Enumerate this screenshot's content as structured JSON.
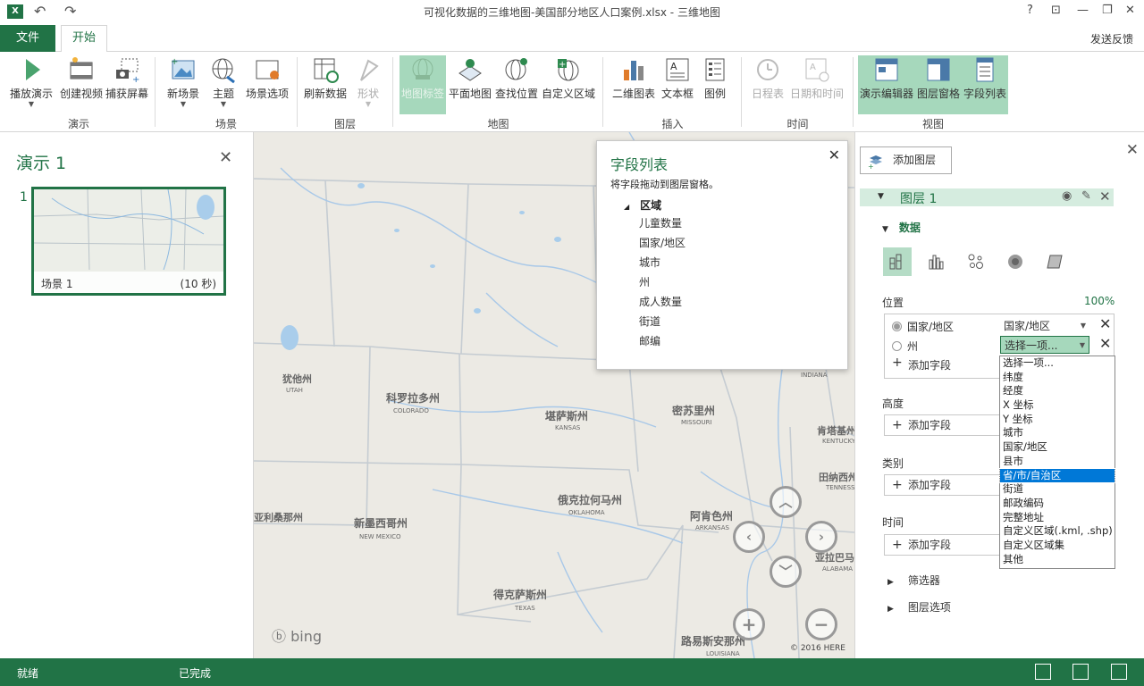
{
  "titlebar": {
    "app_icon": "X",
    "title": "可视化数据的三维地图-美国部分地区人口案例.xlsx - 三维地图",
    "undo_icon": "↶",
    "redo_icon": "↷",
    "help": "?",
    "restore_icon": "⊡",
    "minimize": "—",
    "maximize": "❐",
    "close": "✕"
  },
  "tabs": {
    "file": "文件",
    "home": "开始",
    "feedback": "发送反馈"
  },
  "ribbon": {
    "play_tour": "播放演示",
    "create_video": "创建视频",
    "capture_screen": "捕获屏幕",
    "group_tour": "演示",
    "new_scene": "新场景",
    "theme": "主题",
    "scene_options": "场景选项",
    "group_scene": "场景",
    "refresh_data": "刷新数据",
    "shapes": "形状",
    "group_layer": "图层",
    "map_labels": "地图标签",
    "flat_map": "平面地图",
    "find_location": "查找位置",
    "custom_regions": "自定义区域",
    "group_map": "地图",
    "chart_2d": "二维图表",
    "text_box": "文本框",
    "legend": "图例",
    "group_insert": "插入",
    "timeline": "日程表",
    "date_time": "日期和时间",
    "group_time": "时间",
    "tour_editor": "演示编辑器",
    "layer_pane": "图层窗格",
    "field_list": "字段列表",
    "group_view": "视图"
  },
  "tour": {
    "title": "演示 1",
    "close": "✕",
    "scene_number": "1",
    "scene_name": "场景 1",
    "scene_duration": "(10 秒)"
  },
  "map": {
    "bing": "ⓑ bing",
    "copyright": "© 2016 HERE",
    "labels": [
      "犹他州",
      "UTAH",
      "科罗拉多州",
      "COLORADO",
      "堪萨斯州",
      "KANSAS",
      "密苏里州",
      "MISSOURI",
      "肯塔基州",
      "KENTUCKY",
      "田纳西州",
      "TENNESSEE",
      "俄克拉何马州",
      "OKLAHOMA",
      "阿肯色州",
      "ARKANSAS",
      "新墨西哥州",
      "NEW MEXICO",
      "得克萨斯州",
      "TEXAS",
      "路易斯安那州",
      "LOUISIANA",
      "亚利桑那州",
      "亚拉巴马",
      "ALABAMA",
      "INDIANA"
    ],
    "nav": {
      "up": "︿",
      "left": "‹",
      "right": "›",
      "down": "﹀",
      "zoom_in": "+",
      "zoom_out": "−"
    }
  },
  "field_list": {
    "title": "字段列表",
    "hint": "将字段拖动到图层窗格。",
    "group": "区域",
    "items": [
      "儿童数量",
      "国家/地区",
      "城市",
      "州",
      "成人数量",
      "街道",
      "邮编"
    ],
    "close": "✕"
  },
  "layer_pane": {
    "add_layer": "添加图层",
    "close": "✕",
    "layer_name": "图层 1",
    "data_section": "数据",
    "location_label": "位置",
    "location_percent": "100%",
    "location_rows": [
      {
        "field": "国家/地区",
        "type": "国家/地区"
      },
      {
        "field": "州",
        "type": "选择一项..."
      }
    ],
    "add_field": "添加字段",
    "height_label": "高度",
    "category_label": "类别",
    "time_label": "时间",
    "filters": "筛选器",
    "layer_options": "图层选项",
    "dropdown_options": [
      "选择一项...",
      "纬度",
      "经度",
      "X 坐标",
      "Y 坐标",
      "城市",
      "国家/地区",
      "县市",
      "省/市/自治区",
      "街道",
      "邮政编码",
      "完整地址",
      "自定义区域(.kml, .shp)",
      "自定义区域集",
      "其他"
    ],
    "dropdown_selected": "省/市/自治区"
  },
  "status": {
    "ready": "就绪",
    "completed": "已完成"
  },
  "colors": {
    "accent": "#217346",
    "selected": "#a6d8bc",
    "highlight": "#0078d7"
  }
}
